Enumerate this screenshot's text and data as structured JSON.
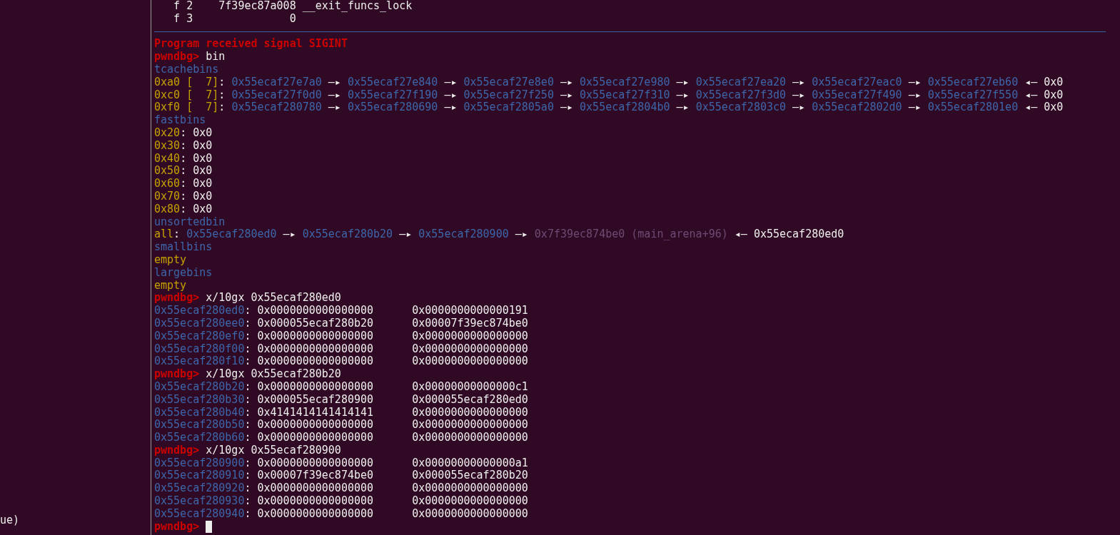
{
  "left_pane": {
    "text": "ue)"
  },
  "terminal": {
    "cursor_visible": true,
    "lines": [
      {
        "kind": "text",
        "segments": [
          {
            "kind": "plain",
            "text": "   f 2    7f39ec87a008 __exit_funcs_lock"
          }
        ]
      },
      {
        "kind": "text",
        "segments": [
          {
            "kind": "plain",
            "text": "   f 3               0"
          }
        ]
      },
      {
        "kind": "rule"
      },
      {
        "kind": "text",
        "segments": [
          {
            "kind": "error",
            "text": "Program received signal SIGINT"
          }
        ]
      },
      {
        "kind": "text",
        "segments": [
          {
            "kind": "prompt",
            "text": "pwndbg> "
          },
          {
            "kind": "command",
            "text": "bin"
          }
        ]
      },
      {
        "kind": "text",
        "segments": [
          {
            "kind": "heading",
            "text": "tcachebins"
          }
        ]
      },
      {
        "kind": "text",
        "segments": [
          {
            "kind": "bucket",
            "text": "0xa0 [  7]"
          },
          {
            "kind": "plain",
            "text": ": "
          },
          {
            "kind": "addr",
            "text": "0x55ecaf27e7a0"
          },
          {
            "kind": "arrow",
            "text": " —▸ "
          },
          {
            "kind": "addr",
            "text": "0x55ecaf27e840"
          },
          {
            "kind": "arrow",
            "text": " —▸ "
          },
          {
            "kind": "addr",
            "text": "0x55ecaf27e8e0"
          },
          {
            "kind": "arrow",
            "text": " —▸ "
          },
          {
            "kind": "addr",
            "text": "0x55ecaf27e980"
          },
          {
            "kind": "arrow",
            "text": " —▸ "
          },
          {
            "kind": "addr",
            "text": "0x55ecaf27ea20"
          },
          {
            "kind": "arrow",
            "text": " —▸ "
          },
          {
            "kind": "addr",
            "text": "0x55ecaf27eac0"
          },
          {
            "kind": "arrow",
            "text": " —▸ "
          },
          {
            "kind": "addr",
            "text": "0x55ecaf27eb60"
          },
          {
            "kind": "arrow",
            "text": " ◂— "
          },
          {
            "kind": "plain",
            "text": "0x0"
          }
        ]
      },
      {
        "kind": "text",
        "segments": [
          {
            "kind": "bucket",
            "text": "0xc0 [  7]"
          },
          {
            "kind": "plain",
            "text": ": "
          },
          {
            "kind": "addr",
            "text": "0x55ecaf27f0d0"
          },
          {
            "kind": "arrow",
            "text": " —▸ "
          },
          {
            "kind": "addr",
            "text": "0x55ecaf27f190"
          },
          {
            "kind": "arrow",
            "text": " —▸ "
          },
          {
            "kind": "addr",
            "text": "0x55ecaf27f250"
          },
          {
            "kind": "arrow",
            "text": " —▸ "
          },
          {
            "kind": "addr",
            "text": "0x55ecaf27f310"
          },
          {
            "kind": "arrow",
            "text": " —▸ "
          },
          {
            "kind": "addr",
            "text": "0x55ecaf27f3d0"
          },
          {
            "kind": "arrow",
            "text": " —▸ "
          },
          {
            "kind": "addr",
            "text": "0x55ecaf27f490"
          },
          {
            "kind": "arrow",
            "text": " —▸ "
          },
          {
            "kind": "addr",
            "text": "0x55ecaf27f550"
          },
          {
            "kind": "arrow",
            "text": " ◂— "
          },
          {
            "kind": "plain",
            "text": "0x0"
          }
        ]
      },
      {
        "kind": "text",
        "segments": [
          {
            "kind": "bucket",
            "text": "0xf0 [  7]"
          },
          {
            "kind": "plain",
            "text": ": "
          },
          {
            "kind": "addr",
            "text": "0x55ecaf280780"
          },
          {
            "kind": "arrow",
            "text": " —▸ "
          },
          {
            "kind": "addr",
            "text": "0x55ecaf280690"
          },
          {
            "kind": "arrow",
            "text": " —▸ "
          },
          {
            "kind": "addr",
            "text": "0x55ecaf2805a0"
          },
          {
            "kind": "arrow",
            "text": " —▸ "
          },
          {
            "kind": "addr",
            "text": "0x55ecaf2804b0"
          },
          {
            "kind": "arrow",
            "text": " —▸ "
          },
          {
            "kind": "addr",
            "text": "0x55ecaf2803c0"
          },
          {
            "kind": "arrow",
            "text": " —▸ "
          },
          {
            "kind": "addr",
            "text": "0x55ecaf2802d0"
          },
          {
            "kind": "arrow",
            "text": " —▸ "
          },
          {
            "kind": "addr",
            "text": "0x55ecaf2801e0"
          },
          {
            "kind": "arrow",
            "text": " ◂— "
          },
          {
            "kind": "plain",
            "text": "0x0"
          }
        ]
      },
      {
        "kind": "text",
        "segments": [
          {
            "kind": "heading",
            "text": "fastbins"
          }
        ]
      },
      {
        "kind": "text",
        "segments": [
          {
            "kind": "bucket",
            "text": "0x20"
          },
          {
            "kind": "plain",
            "text": ": 0x0"
          }
        ]
      },
      {
        "kind": "text",
        "segments": [
          {
            "kind": "bucket",
            "text": "0x30"
          },
          {
            "kind": "plain",
            "text": ": 0x0"
          }
        ]
      },
      {
        "kind": "text",
        "segments": [
          {
            "kind": "bucket",
            "text": "0x40"
          },
          {
            "kind": "plain",
            "text": ": 0x0"
          }
        ]
      },
      {
        "kind": "text",
        "segments": [
          {
            "kind": "bucket",
            "text": "0x50"
          },
          {
            "kind": "plain",
            "text": ": 0x0"
          }
        ]
      },
      {
        "kind": "text",
        "segments": [
          {
            "kind": "bucket",
            "text": "0x60"
          },
          {
            "kind": "plain",
            "text": ": 0x0"
          }
        ]
      },
      {
        "kind": "text",
        "segments": [
          {
            "kind": "bucket",
            "text": "0x70"
          },
          {
            "kind": "plain",
            "text": ": 0x0"
          }
        ]
      },
      {
        "kind": "text",
        "segments": [
          {
            "kind": "bucket",
            "text": "0x80"
          },
          {
            "kind": "plain",
            "text": ": 0x0"
          }
        ]
      },
      {
        "kind": "text",
        "segments": [
          {
            "kind": "heading",
            "text": "unsortedbin"
          }
        ]
      },
      {
        "kind": "text",
        "segments": [
          {
            "kind": "bucket",
            "text": "all"
          },
          {
            "kind": "plain",
            "text": ": "
          },
          {
            "kind": "addr",
            "text": "0x55ecaf280ed0"
          },
          {
            "kind": "arrow",
            "text": " —▸ "
          },
          {
            "kind": "addr",
            "text": "0x55ecaf280b20"
          },
          {
            "kind": "arrow",
            "text": " —▸ "
          },
          {
            "kind": "addr",
            "text": "0x55ecaf280900"
          },
          {
            "kind": "arrow",
            "text": " —▸ "
          },
          {
            "kind": "libc",
            "text": "0x7f39ec874be0 (main_arena+96)"
          },
          {
            "kind": "arrow",
            "text": " ◂— "
          },
          {
            "kind": "plain",
            "text": "0x55ecaf280ed0"
          }
        ]
      },
      {
        "kind": "text",
        "segments": [
          {
            "kind": "heading",
            "text": "smallbins"
          }
        ]
      },
      {
        "kind": "text",
        "segments": [
          {
            "kind": "bucket",
            "text": "empty"
          }
        ]
      },
      {
        "kind": "text",
        "segments": [
          {
            "kind": "heading",
            "text": "largebins"
          }
        ]
      },
      {
        "kind": "text",
        "segments": [
          {
            "kind": "bucket",
            "text": "empty"
          }
        ]
      },
      {
        "kind": "text",
        "segments": [
          {
            "kind": "prompt",
            "text": "pwndbg> "
          },
          {
            "kind": "command",
            "text": "x/10gx 0x55ecaf280ed0"
          }
        ]
      },
      {
        "kind": "text",
        "segments": [
          {
            "kind": "addr",
            "text": "0x55ecaf280ed0"
          },
          {
            "kind": "plain",
            "text": ": 0x0000000000000000      0x0000000000000191"
          }
        ]
      },
      {
        "kind": "text",
        "segments": [
          {
            "kind": "addr",
            "text": "0x55ecaf280ee0"
          },
          {
            "kind": "plain",
            "text": ": 0x000055ecaf280b20      0x00007f39ec874be0"
          }
        ]
      },
      {
        "kind": "text",
        "segments": [
          {
            "kind": "addr",
            "text": "0x55ecaf280ef0"
          },
          {
            "kind": "plain",
            "text": ": 0x0000000000000000      0x0000000000000000"
          }
        ]
      },
      {
        "kind": "text",
        "segments": [
          {
            "kind": "addr",
            "text": "0x55ecaf280f00"
          },
          {
            "kind": "plain",
            "text": ": 0x0000000000000000      0x0000000000000000"
          }
        ]
      },
      {
        "kind": "text",
        "segments": [
          {
            "kind": "addr",
            "text": "0x55ecaf280f10"
          },
          {
            "kind": "plain",
            "text": ": 0x0000000000000000      0x0000000000000000"
          }
        ]
      },
      {
        "kind": "text",
        "segments": [
          {
            "kind": "prompt",
            "text": "pwndbg> "
          },
          {
            "kind": "command",
            "text": "x/10gx 0x55ecaf280b20"
          }
        ]
      },
      {
        "kind": "text",
        "segments": [
          {
            "kind": "addr",
            "text": "0x55ecaf280b20"
          },
          {
            "kind": "plain",
            "text": ": 0x0000000000000000      0x00000000000000c1"
          }
        ]
      },
      {
        "kind": "text",
        "segments": [
          {
            "kind": "addr",
            "text": "0x55ecaf280b30"
          },
          {
            "kind": "plain",
            "text": ": 0x000055ecaf280900      0x000055ecaf280ed0"
          }
        ]
      },
      {
        "kind": "text",
        "segments": [
          {
            "kind": "addr",
            "text": "0x55ecaf280b40"
          },
          {
            "kind": "plain",
            "text": ": 0x4141414141414141      0x0000000000000000"
          }
        ]
      },
      {
        "kind": "text",
        "segments": [
          {
            "kind": "addr",
            "text": "0x55ecaf280b50"
          },
          {
            "kind": "plain",
            "text": ": 0x0000000000000000      0x0000000000000000"
          }
        ]
      },
      {
        "kind": "text",
        "segments": [
          {
            "kind": "addr",
            "text": "0x55ecaf280b60"
          },
          {
            "kind": "plain",
            "text": ": 0x0000000000000000      0x0000000000000000"
          }
        ]
      },
      {
        "kind": "text",
        "segments": [
          {
            "kind": "prompt",
            "text": "pwndbg> "
          },
          {
            "kind": "command",
            "text": "x/10gx 0x55ecaf280900"
          }
        ]
      },
      {
        "kind": "text",
        "segments": [
          {
            "kind": "addr",
            "text": "0x55ecaf280900"
          },
          {
            "kind": "plain",
            "text": ": 0x0000000000000000      0x00000000000000a1"
          }
        ]
      },
      {
        "kind": "text",
        "segments": [
          {
            "kind": "addr",
            "text": "0x55ecaf280910"
          },
          {
            "kind": "plain",
            "text": ": 0x00007f39ec874be0      0x000055ecaf280b20"
          }
        ]
      },
      {
        "kind": "text",
        "segments": [
          {
            "kind": "addr",
            "text": "0x55ecaf280920"
          },
          {
            "kind": "plain",
            "text": ": 0x0000000000000000      0x0000000000000000"
          }
        ]
      },
      {
        "kind": "text",
        "segments": [
          {
            "kind": "addr",
            "text": "0x55ecaf280930"
          },
          {
            "kind": "plain",
            "text": ": 0x0000000000000000      0x0000000000000000"
          }
        ]
      },
      {
        "kind": "text",
        "segments": [
          {
            "kind": "addr",
            "text": "0x55ecaf280940"
          },
          {
            "kind": "plain",
            "text": ": 0x0000000000000000      0x0000000000000000"
          }
        ]
      },
      {
        "kind": "text",
        "segments": [
          {
            "kind": "prompt",
            "text": "pwndbg> "
          }
        ]
      }
    ]
  }
}
